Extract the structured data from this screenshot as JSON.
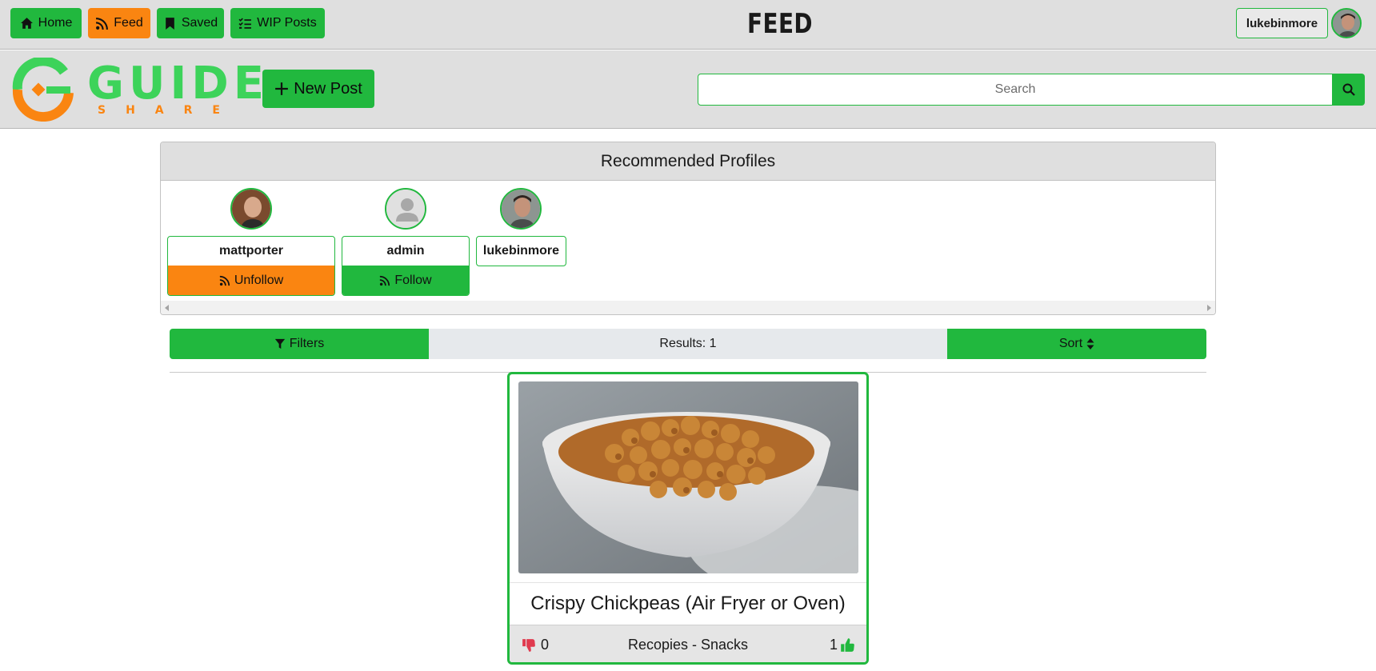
{
  "nav": {
    "home_label": "Home",
    "feed_label": "Feed",
    "saved_label": "Saved",
    "wip_label": "WIP Posts",
    "page_title": "FEED",
    "username": "lukebinmore"
  },
  "logo": {
    "word": "GUIDE",
    "sub": "SHARE"
  },
  "header": {
    "new_post_label": "New Post",
    "search_placeholder": "Search"
  },
  "recommended": {
    "title": "Recommended Profiles",
    "profiles": [
      {
        "name": "mattporter",
        "action": "Unfollow"
      },
      {
        "name": "admin",
        "action": "Follow"
      },
      {
        "name": "lukebinmore",
        "action": ""
      }
    ]
  },
  "filterbar": {
    "filters_label": "Filters",
    "results_label": "Results: 1",
    "sort_label": "Sort"
  },
  "post": {
    "title": "Crispy Chickpeas (Air Fryer or Oven)",
    "dislikes": "0",
    "category": "Recopies - Snacks",
    "likes": "1"
  },
  "colors": {
    "accent_green": "#21b83e",
    "accent_orange": "#fa8511",
    "header_bg": "#dfdfdf"
  }
}
